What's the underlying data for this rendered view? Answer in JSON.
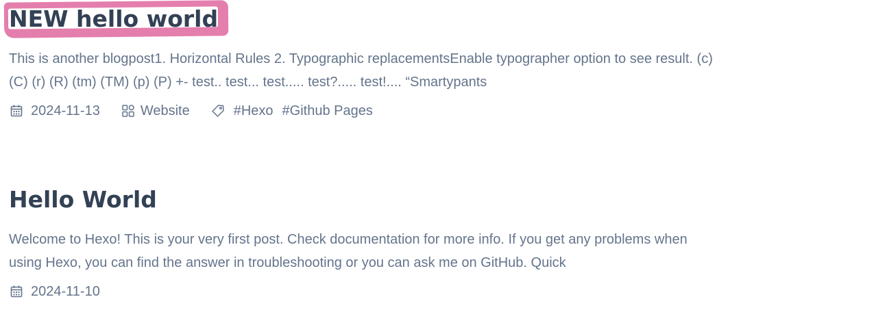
{
  "posts": [
    {
      "title": "NEW hello world",
      "excerpt_line1": "This is another blogpost1. Horizontal Rules 2. Typographic replacementsEnable typographer option to see result. (c)",
      "excerpt_line2": "(C) (r) (R) (tm) (TM) (p) (P) +- test.. test... test..... test?..... test!.... “Smartypants",
      "date": "2024-11-13",
      "category": "Website",
      "tags": [
        "#Hexo",
        "#Github Pages"
      ],
      "icons": {
        "date": "calendar-icon",
        "category": "category-grid-icon",
        "tags": "tag-icon"
      }
    },
    {
      "title": "Hello World",
      "excerpt_line1": "Welcome to Hexo! This is your very first post. Check documentation for more info. If you get any problems when",
      "excerpt_line2": "using Hexo, you can find the answer in troubleshooting or you can ask me on GitHub. Quick",
      "date": "2024-11-10",
      "icons": {
        "date": "calendar-icon"
      }
    }
  ],
  "colors": {
    "title": "#334155",
    "text": "#64748b",
    "highlight": "#e47ead",
    "background": "#ffffff"
  }
}
